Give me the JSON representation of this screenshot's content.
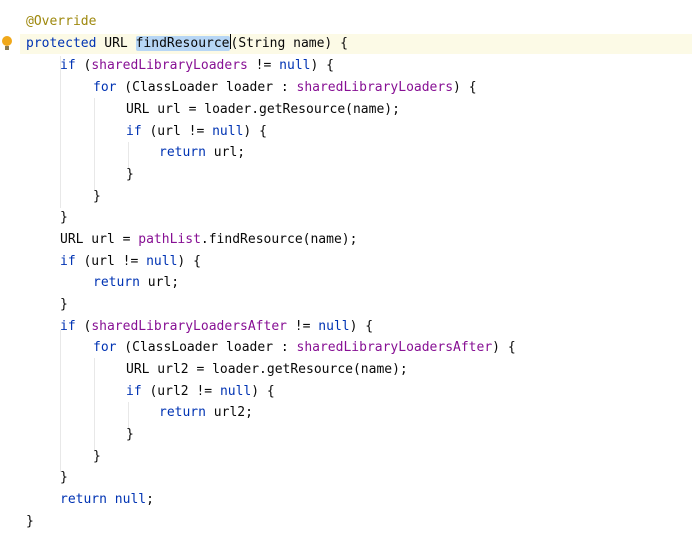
{
  "code": {
    "annotation": "@Override",
    "decl": {
      "kw": "protected",
      "type": " URL ",
      "method": "findResource",
      "rest": "(String name) {"
    },
    "l3": {
      "kw": "if",
      "a": " (",
      "field": "sharedLibraryLoaders",
      "b": " != ",
      "kw2": "null",
      "c": ") {"
    },
    "l4": {
      "kw": "for",
      "a": " (ClassLoader loader : ",
      "field": "sharedLibraryLoaders",
      "b": ") {"
    },
    "l5": "URL url = loader.getResource(name);",
    "l6": {
      "kw": "if",
      "a": " (url != ",
      "kw2": "null",
      "b": ") {"
    },
    "l7": {
      "kw": "return",
      "a": " url;"
    },
    "l8": "}",
    "l9": "}",
    "l10": "}",
    "l11": {
      "a": "URL url = ",
      "field": "pathList",
      "b": ".findResource(name);"
    },
    "l12": {
      "kw": "if",
      "a": " (url != ",
      "kw2": "null",
      "b": ") {"
    },
    "l13": {
      "kw": "return",
      "a": " url;"
    },
    "l14": "}",
    "l15": {
      "kw": "if",
      "a": " (",
      "field": "sharedLibraryLoadersAfter",
      "b": " != ",
      "kw2": "null",
      "c": ") {"
    },
    "l16": {
      "kw": "for",
      "a": " (ClassLoader loader : ",
      "field": "sharedLibraryLoadersAfter",
      "b": ") {"
    },
    "l17": "URL url2 = loader.getResource(name);",
    "l18": {
      "kw": "if",
      "a": " (url2 != ",
      "kw2": "null",
      "b": ") {"
    },
    "l19": {
      "kw": "return",
      "a": " url2;"
    },
    "l20": "}",
    "l21": "}",
    "l22": "}",
    "l23": {
      "kw": "return",
      "kw2": " null",
      "a": ";"
    },
    "l24": "}"
  },
  "colors": {
    "keyword": "#0033b3",
    "field": "#871094",
    "annotation": "#9e880d",
    "text": "#080808",
    "highlight": "#b7d6f5",
    "current_line": "#fcfae6",
    "intention_bulb": "#f0a81a"
  },
  "icons": {
    "gutter": "intention-bulb-icon"
  }
}
